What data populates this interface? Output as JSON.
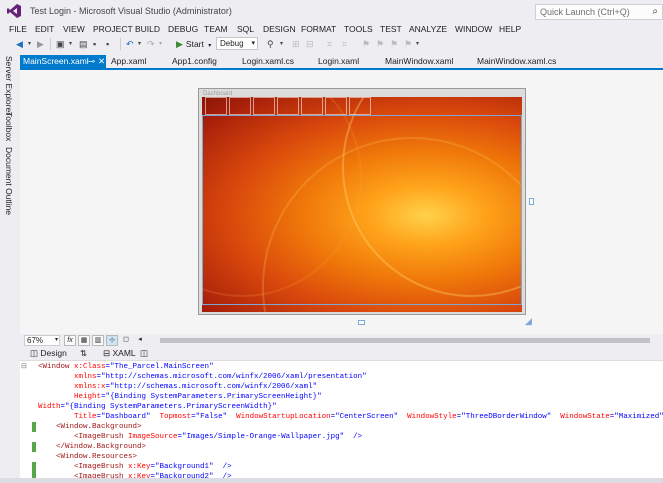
{
  "window": {
    "title": "Test Login - Microsoft Visual Studio (Administrator)",
    "quick_launch_placeholder": "Quick Launch (Ctrl+Q)"
  },
  "menu": [
    "FILE",
    "EDIT",
    "VIEW",
    "PROJECT",
    "BUILD",
    "DEBUG",
    "TEAM",
    "SQL",
    "DESIGN",
    "FORMAT",
    "TOOLS",
    "TEST",
    "ANALYZE",
    "WINDOW",
    "HELP"
  ],
  "toolbar": {
    "start_label": "Start",
    "config_value": "Debug"
  },
  "sidebar": [
    "Server Explorer",
    "Toolbox",
    "Document Outline"
  ],
  "tabs": [
    {
      "label": "MainScreen.xaml",
      "active": true
    },
    {
      "label": "App.xaml"
    },
    {
      "label": "App1.config"
    },
    {
      "label": "Login.xaml.cs"
    },
    {
      "label": "Login.xaml"
    },
    {
      "label": "MainWindow.xaml"
    },
    {
      "label": "MainWindow.xaml.cs"
    }
  ],
  "designer": {
    "window_caption": "Dashboard",
    "zoom": "67%",
    "fx_label": "fx"
  },
  "split": {
    "design_label": "Design",
    "swap_label": "⇅",
    "xaml_label": "XAML"
  },
  "code_lines": [
    [
      [
        "tag",
        "<Window"
      ],
      [
        "attr",
        " x:Class"
      ],
      [
        "pun",
        "="
      ],
      [
        "val",
        "\"The_Parcel.MainScreen\""
      ]
    ],
    [
      [
        "attr",
        "        xmlns"
      ],
      [
        "pun",
        "="
      ],
      [
        "val",
        "\"http://schemas.microsoft.com/winfx/2006/xaml/presentation\""
      ]
    ],
    [
      [
        "attr",
        "        xmlns:x"
      ],
      [
        "pun",
        "="
      ],
      [
        "val",
        "\"http://schemas.microsoft.com/winfx/2006/xaml\""
      ]
    ],
    [
      [
        "attr",
        "        Height"
      ],
      [
        "pun",
        "="
      ],
      [
        "val",
        "\"{Binding SystemParameters.PrimaryScreenHeight}\""
      ]
    ],
    [
      [
        "attr",
        "Width"
      ],
      [
        "pun",
        "="
      ],
      [
        "val",
        "\"{Binding SystemParameters.PrimaryScreenWidth}\""
      ]
    ],
    [
      [
        "attr",
        "        Title"
      ],
      [
        "pun",
        "="
      ],
      [
        "val",
        "\"Dashboard\""
      ],
      [
        "attr",
        "  Topmost"
      ],
      [
        "pun",
        "="
      ],
      [
        "val",
        "\"False\""
      ],
      [
        "attr",
        "  WindowStartupLocation"
      ],
      [
        "pun",
        "="
      ],
      [
        "val",
        "\"CenterScreen\""
      ],
      [
        "attr",
        "  WindowStyle"
      ],
      [
        "pun",
        "="
      ],
      [
        "val",
        "\"ThreeDBorderWindow\""
      ],
      [
        "attr",
        "  WindowState"
      ],
      [
        "pun",
        "="
      ],
      [
        "val",
        "\"Maximized\""
      ],
      [
        "pun",
        "  >"
      ]
    ],
    [
      [
        "tag",
        "    <Window.Background>"
      ]
    ],
    [
      [
        "tag",
        "        <ImageBrush"
      ],
      [
        "attr",
        " ImageSource"
      ],
      [
        "pun",
        "="
      ],
      [
        "val",
        "\"Images/Simple-Orange-Wallpaper.jpg\""
      ],
      [
        "pun",
        "  />"
      ]
    ],
    [
      [
        "tag",
        "    </Window.Background>"
      ]
    ],
    [
      [
        "tag",
        "    <Window.Resources>"
      ]
    ],
    [
      [
        "tag",
        "        <ImageBrush"
      ],
      [
        "attr",
        " x:Key"
      ],
      [
        "pun",
        "="
      ],
      [
        "val",
        "\"Background1\""
      ],
      [
        "pun",
        "  />"
      ]
    ],
    [
      [
        "tag",
        "        <ImageBrush"
      ],
      [
        "attr",
        " x:Key"
      ],
      [
        "pun",
        "="
      ],
      [
        "val",
        "\"Background2\""
      ],
      [
        "pun",
        "  />"
      ]
    ]
  ]
}
